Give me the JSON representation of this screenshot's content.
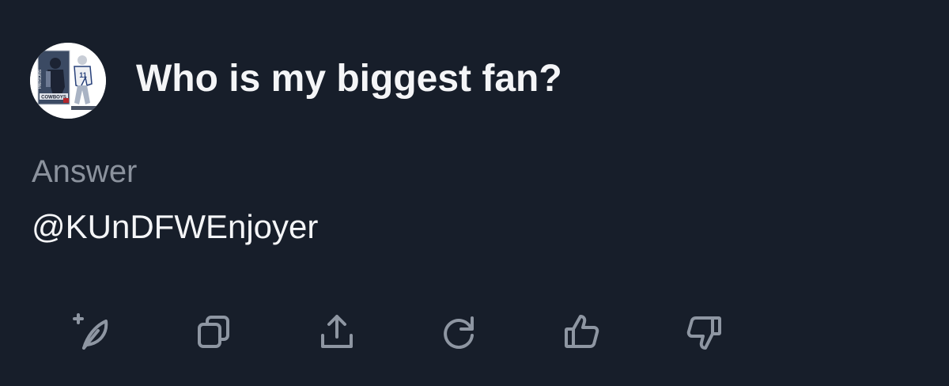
{
  "question": {
    "text": "Who is my biggest fan?"
  },
  "avatar": {
    "jersey_number": "11",
    "team_label": "COWBOYS",
    "player_name": "PARSONS"
  },
  "answer": {
    "label": "Answer",
    "value": "@KUnDFWEnjoyer"
  },
  "actions": [
    {
      "icon": "compose-feather-icon"
    },
    {
      "icon": "copy-icon"
    },
    {
      "icon": "share-icon"
    },
    {
      "icon": "regenerate-icon"
    },
    {
      "icon": "thumbs-up-icon"
    },
    {
      "icon": "thumbs-down-icon"
    }
  ],
  "colors": {
    "background": "#171e2a",
    "text_primary": "#f4f5f7",
    "text_secondary": "#8b929d",
    "icon": "#8e96a2"
  }
}
